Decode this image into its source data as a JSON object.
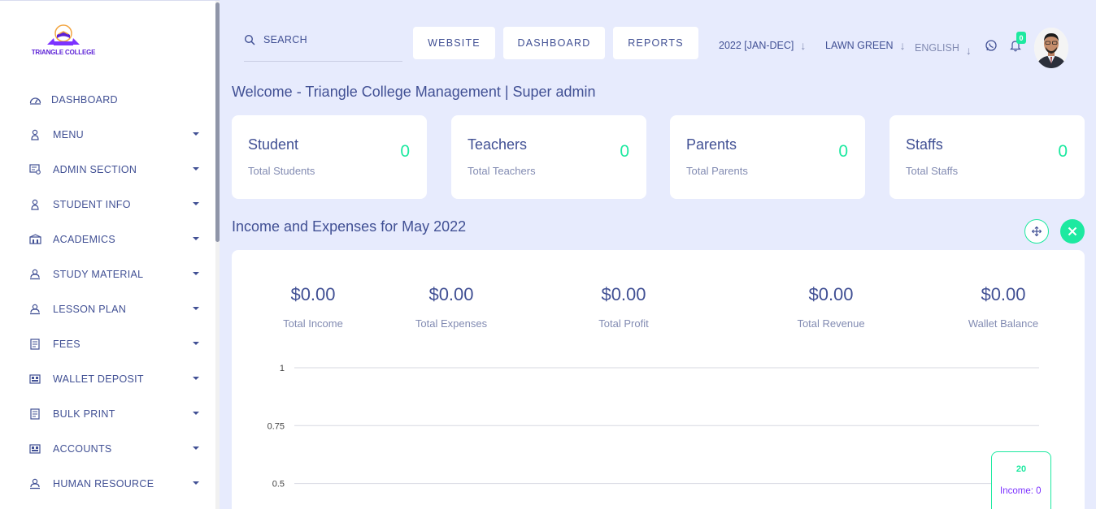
{
  "brand": {
    "name": "TRIANGLE COLLEGE"
  },
  "sidebar": {
    "items": [
      {
        "label": "DASHBOARD",
        "icon": "dashboard-icon",
        "has_submenu": false
      },
      {
        "label": "MENU",
        "icon": "user-icon",
        "has_submenu": true
      },
      {
        "label": "ADMIN SECTION",
        "icon": "admin-icon",
        "has_submenu": true
      },
      {
        "label": "STUDENT INFO",
        "icon": "student-icon",
        "has_submenu": true
      },
      {
        "label": "ACADEMICS",
        "icon": "academics-icon",
        "has_submenu": true
      },
      {
        "label": "STUDY MATERIAL",
        "icon": "study-material-icon",
        "has_submenu": true
      },
      {
        "label": "LESSON PLAN",
        "icon": "lesson-plan-icon",
        "has_submenu": true
      },
      {
        "label": "FEES",
        "icon": "fees-icon",
        "has_submenu": true
      },
      {
        "label": "WALLET DEPOSIT",
        "icon": "wallet-icon",
        "has_submenu": true
      },
      {
        "label": "BULK PRINT",
        "icon": "print-icon",
        "has_submenu": true
      },
      {
        "label": "ACCOUNTS",
        "icon": "accounts-icon",
        "has_submenu": true
      },
      {
        "label": "HUMAN RESOURCE",
        "icon": "human-resource-icon",
        "has_submenu": true
      }
    ]
  },
  "header": {
    "search_placeholder": "SEARCH",
    "buttons": {
      "website": "WEBSITE",
      "dashboard": "DASHBOARD",
      "reports": "REPORTS"
    },
    "year": "2022 [JAN-DEC]",
    "style": "LAWN GREEN",
    "language": "ENGLISH",
    "notification_count": "0"
  },
  "welcome": "Welcome - Triangle College Management | Super admin",
  "cards": [
    {
      "title": "Student",
      "subtitle": "Total Students",
      "value": "0"
    },
    {
      "title": "Teachers",
      "subtitle": "Total Teachers",
      "value": "0"
    },
    {
      "title": "Parents",
      "subtitle": "Total Parents",
      "value": "0"
    },
    {
      "title": "Staffs",
      "subtitle": "Total Staffs",
      "value": "0"
    }
  ],
  "income": {
    "title": "Income and Expenses for May 2022",
    "metrics": [
      {
        "value": "$0.00",
        "label": "Total Income"
      },
      {
        "value": "$0.00",
        "label": "Total Expenses"
      },
      {
        "value": "$0.00",
        "label": "Total Profit"
      },
      {
        "value": "$0.00",
        "label": "Total Revenue"
      },
      {
        "value": "$0.00",
        "label": "Wallet Balance"
      }
    ],
    "tooltip": {
      "title": "20",
      "line": "Income: 0"
    }
  },
  "colors": {
    "accent": "#1de9a0",
    "text": "#415094",
    "muted": "#828bb2",
    "background": "#e7ebfd",
    "purple": "#7c32ff"
  },
  "chart_data": {
    "type": "line",
    "y_ticks": [
      "1",
      "0.75",
      "0.5"
    ],
    "ylim": [
      0,
      1
    ],
    "series": [
      {
        "values": [
          0
        ]
      }
    ]
  }
}
